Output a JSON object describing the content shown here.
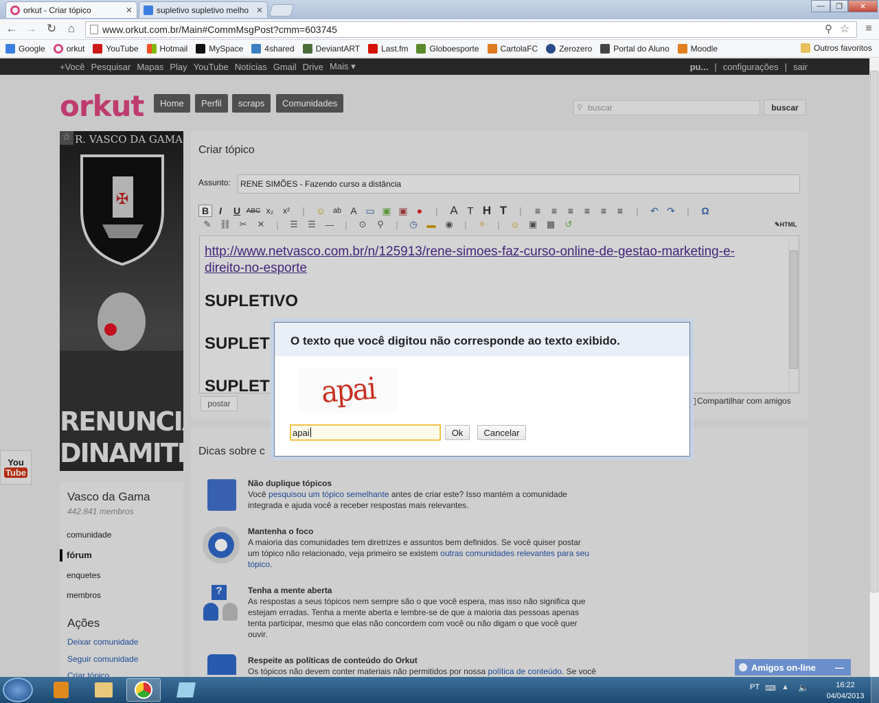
{
  "browser": {
    "tabs": [
      {
        "title": "orkut - Criar tópico"
      },
      {
        "title": "supletivo supletivo melho"
      }
    ],
    "url": "www.orkut.com.br/Main#CommMsgPost?cmm=603745",
    "bookmarks": [
      "Google",
      "orkut",
      "YouTube",
      "Hotmail",
      "MySpace",
      "4shared",
      "DeviantART",
      "Last.fm",
      "Globoesporte",
      "CartolaFC",
      "Zerozero",
      "Portal do Aluno",
      "Moodle"
    ],
    "other_bookmarks": "Outros favoritos"
  },
  "gbar": {
    "left": [
      "+Você",
      "Pesquisar",
      "Mapas",
      "Play",
      "YouTube",
      "Notícias",
      "Gmail",
      "Drive",
      "Mais ▾"
    ],
    "user": "pu...",
    "settings": "configurações",
    "logout": "sair",
    "sep": "|"
  },
  "header": {
    "logo": "orkut",
    "nav": [
      "Home",
      "Perfil",
      "scraps",
      "Comunidades"
    ],
    "search_placeholder": "buscar",
    "search_button": "buscar"
  },
  "community": {
    "banner_top": "R. VASCO DA GAMA",
    "banner_bottom1": "RENUNCIA",
    "banner_bottom2": "DINAMITE",
    "name": "Vasco da Gama",
    "members": "442.841 membros",
    "menu": [
      "comunidade",
      "fórum",
      "enquetes",
      "membros"
    ],
    "actions_title": "Ações",
    "actions": [
      "Deixar comunidade",
      "Seguir comunidade",
      "Criar tópico"
    ]
  },
  "composer": {
    "title": "Criar tópico",
    "subject_label": "Assunto:",
    "subject_value": "RENE SIMÕES - Fazendo curso a distância",
    "html_label": "HTML",
    "link_line1": "http://www.netvasco.com.br/n/125913/rene-simoes-faz-curso-online-de-gestao-marketing-e-",
    "link_line2": "direito-no-esporte",
    "heading1": "SUPLETIVO",
    "heading2": "SUPLET",
    "heading3": "SUPLET",
    "post_button": "postar",
    "share_label": "Compartilhar com amigos"
  },
  "tips": {
    "title": "Dicas sobre c",
    "items": [
      {
        "title": "Não duplique tópicos",
        "text1": "Você ",
        "link1": "pesquisou um tópico semelhante",
        "text2": " antes de criar este? Isso mantém a comunidade",
        "text3": "integrada e ajuda você a receber respostas mais relevantes."
      },
      {
        "title": "Mantenha o foco",
        "text1": "A maioria das comunidades tem diretrizes e assuntos bem definidos. Se você quiser postar",
        "text2": "um tópico não relacionado, veja primeiro se existem ",
        "link1": "outras comunidades relevantes para seu",
        "link2": "tópico",
        "text3": "."
      },
      {
        "title": "Tenha a mente aberta",
        "text1": "As respostas a seus tópicos nem sempre são o que você espera, mas isso não significa que",
        "text2": "estejam erradas. Tenha a mente aberta e lembre-se de que a maioria das pessoas apenas",
        "text3": "tenta participar, mesmo que elas não concordem com você ou não digam o que você quer",
        "text4": "ouvir."
      },
      {
        "title": "Respeite as políticas de conteúdo do Orkut",
        "text1": "Os tópicos não devem conter materiais não permitidos por nossa ",
        "link1": "política de conteúdo",
        "text2": ". Se você"
      }
    ]
  },
  "dialog": {
    "message": "O texto que você digitou não corresponde ao texto exibido.",
    "captcha": "apai",
    "input_value": "apai",
    "ok": "Ok",
    "cancel": "Cancelar"
  },
  "chat": {
    "label": "Amigos on-line"
  },
  "taskbar": {
    "lang": "PT",
    "time": "16:22",
    "date": "04/04/2013"
  },
  "youtube_side": {
    "line1": "You",
    "line2": "Tube"
  },
  "colors": {
    "orkut_pink": "#d9457e",
    "link_blue": "#2255aa",
    "taskbar": "#1c4a72"
  }
}
